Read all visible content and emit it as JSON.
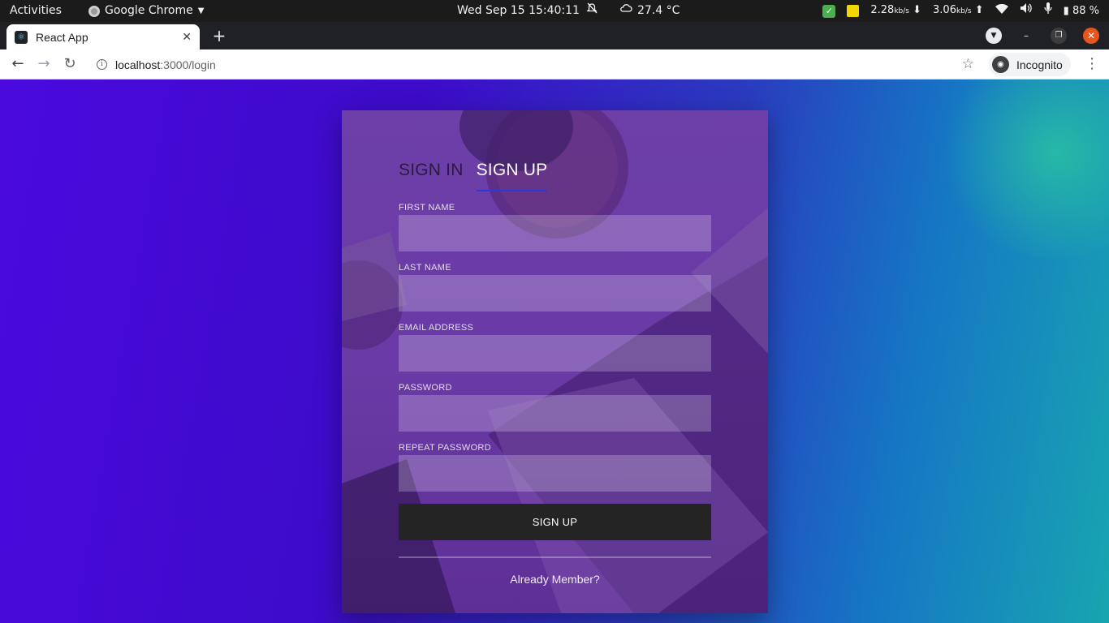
{
  "system_bar": {
    "activities": "Activities",
    "app_name": "Google Chrome",
    "datetime": "Wed Sep 15  15:40:11",
    "weather": "27.4 °C",
    "net_down": "2.28",
    "net_down_unit": "kb/s",
    "net_up": "3.06",
    "net_up_unit": "kb/s",
    "battery": "88 %"
  },
  "browser": {
    "tab_title": "React App",
    "url_host": "localhost",
    "url_path": ":3000/login",
    "incognito_label": "Incognito"
  },
  "form": {
    "tabs": [
      {
        "label": "SIGN IN",
        "active": false
      },
      {
        "label": "SIGN UP",
        "active": true
      }
    ],
    "fields": [
      {
        "label": "FIRST NAME",
        "value": ""
      },
      {
        "label": "LAST NAME",
        "value": ""
      },
      {
        "label": "EMAIL ADDRESS",
        "value": ""
      },
      {
        "label": "PASSWORD",
        "value": ""
      },
      {
        "label": "REPEAT PASSWORD",
        "value": ""
      }
    ],
    "submit_label": "SIGN UP",
    "footer_link": "Already Member?"
  },
  "colors": {
    "page_gradient_start": "#4a0ade",
    "page_gradient_end": "#18a5b0",
    "card_tint": "#6a3aa6",
    "active_tab_underline": "#2b3ad6",
    "button_bg": "#242424"
  }
}
